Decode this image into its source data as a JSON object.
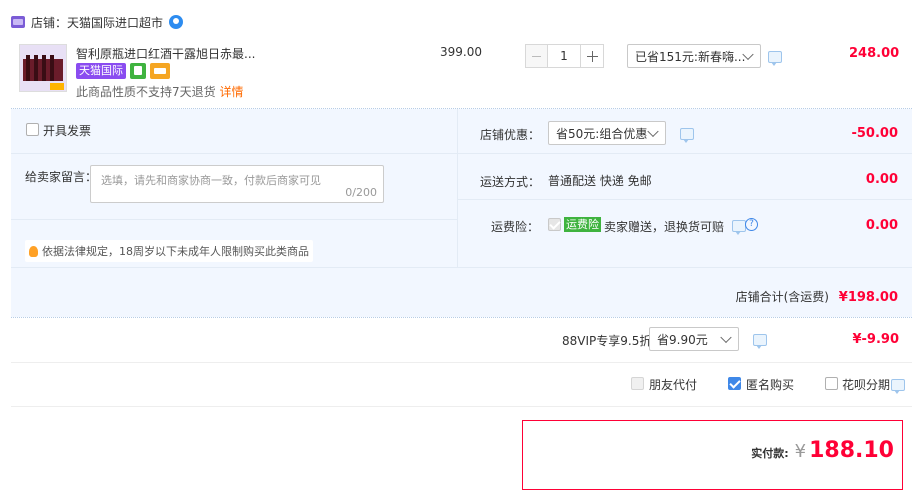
{
  "store": {
    "label": "店铺：",
    "name": "天猫国际进口超市"
  },
  "item": {
    "title": "智利原瓶进口红酒干露旭日赤最...",
    "badge": "天猫国际",
    "note": "此商品性质不支持7天退货",
    "note_link": "详情",
    "unit_price": "399.00",
    "quantity": "1",
    "discount_select": "已省151元:新春嗨...",
    "subtotal": "248.00"
  },
  "order": {
    "invoice_label": "开具发票",
    "message_label": "给卖家留言：",
    "message_placeholder": "选填，请先和商家协商一致，付款后商家可见",
    "message_counter": "0/200",
    "legal_notice": "依据法律规定，18周岁以下未成年人限制购买此类商品",
    "shop_discount_label": "店铺优惠：",
    "shop_discount_select": "省50元:组合优惠",
    "shop_discount_value": "-50.00",
    "shipping_label": "运送方式：",
    "shipping_value": "普通配送 快递 免邮",
    "shipping_price": "0.00",
    "insurance_label": "运费险：",
    "insurance_badge": "运费险",
    "insurance_text": "卖家赠送，退换货可赔",
    "insurance_price": "0.00",
    "store_total_label": "店铺合计(含运费)",
    "store_total_value": "¥198.00"
  },
  "vip": {
    "label": "88VIP专享9.5折",
    "select": "省9.90元",
    "value": "¥-9.90"
  },
  "options": {
    "friend_pay": "朋友代付",
    "friend_pay_checked": false,
    "anonymous": "匿名购买",
    "anonymous_checked": true,
    "huabei": "花呗分期",
    "huabei_checked": false
  },
  "payment": {
    "label": "实付款:",
    "currency": "¥",
    "amount": "188.10"
  },
  "colors": {
    "price_red": "#ff0036",
    "panel_blue": "#f2f7ff",
    "accent_blue": "#3f88e8",
    "tmall_purple": "#8a4cf0"
  }
}
